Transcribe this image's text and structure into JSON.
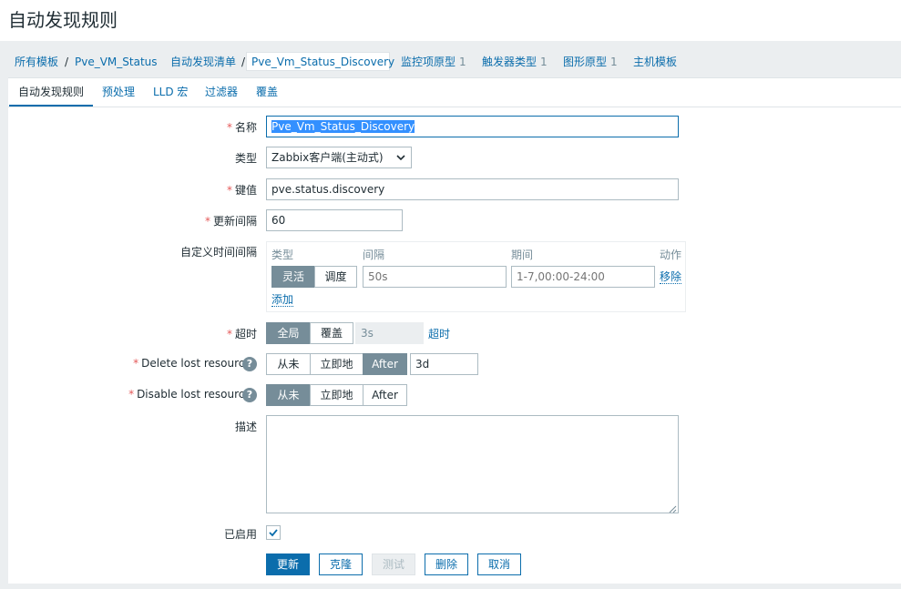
{
  "page": {
    "title": "自动发现规则"
  },
  "breadcrumb": {
    "all_templates": "所有模板",
    "template": "Pve_VM_Status",
    "discovery_list": "自动发现清单",
    "current_rule": "Pve_Vm_Status_Discovery",
    "item_prototypes": "监控项原型",
    "item_prototypes_count": "1",
    "trigger_types": "触发器类型",
    "trigger_types_count": "1",
    "graph_prototypes": "图形原型",
    "graph_prototypes_count": "1",
    "host_templates": "主机模板"
  },
  "tabs": [
    "自动发现规则",
    "预处理",
    "LLD 宏",
    "过滤器",
    "覆盖"
  ],
  "form": {
    "name_label": "名称",
    "name_value": "Pve_Vm_Status_Discovery",
    "type_label": "类型",
    "type_value": "Zabbix客户端(主动式)",
    "key_label": "键值",
    "key_value": "pve.status.discovery",
    "interval_label": "更新间隔",
    "interval_value": "60",
    "custom_intervals_label": "自定义时间间隔",
    "custom_intervals": {
      "col_type": "类型",
      "col_interval": "间隔",
      "col_period": "期间",
      "col_action": "动作",
      "flexible": "灵活",
      "scheduling": "调度",
      "interval_placeholder": "50s",
      "period_placeholder": "1-7,00:00-24:00",
      "remove": "移除",
      "add": "添加"
    },
    "timeout_label": "超时",
    "timeout_global": "全局",
    "timeout_override": "覆盖",
    "timeout_value": "3s",
    "timeout_link": "超时",
    "delete_lost_label": "Delete lost resources",
    "disable_lost_label": "Disable lost resources",
    "never": "从未",
    "immediately": "立即地",
    "after": "After",
    "delete_after_value": "3d",
    "help_glyph": "?",
    "description_label": "描述",
    "description_value": "",
    "enabled_label": "已启用",
    "enabled": true
  },
  "buttons": {
    "update": "更新",
    "clone": "克隆",
    "test": "测试",
    "delete": "删除",
    "cancel": "取消"
  },
  "colors": {
    "accent": "#0b6dac",
    "required": "#e45959",
    "segment_on": "#768d99"
  }
}
